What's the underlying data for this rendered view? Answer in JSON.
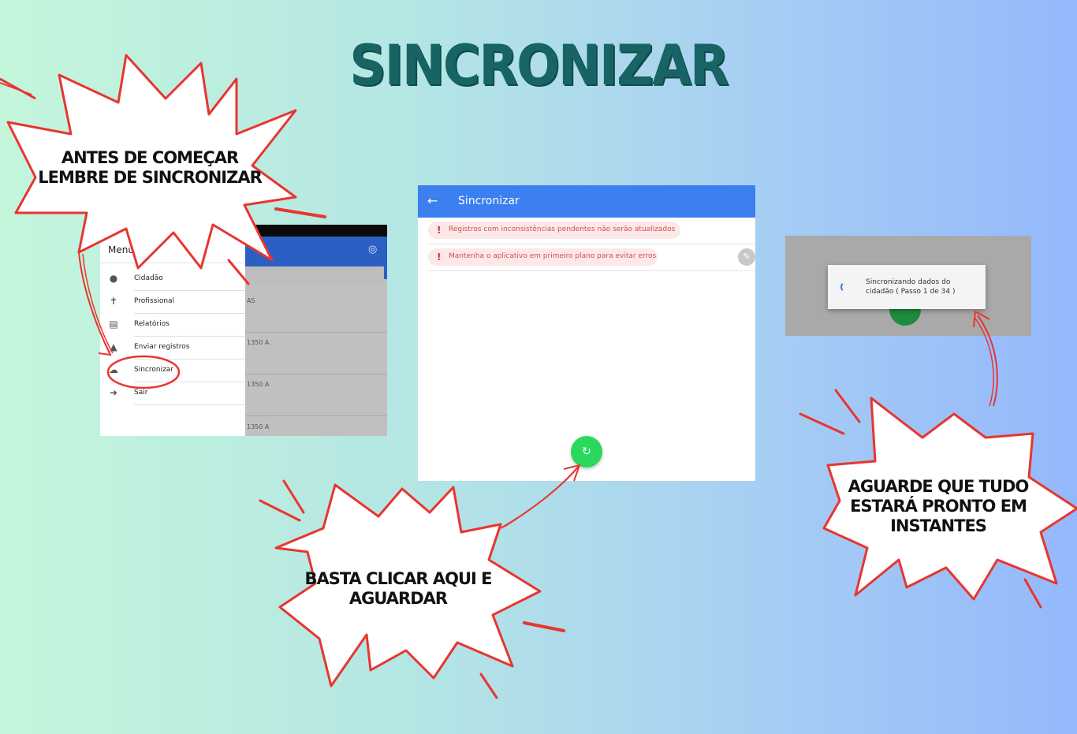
{
  "title": "SINCRONIZAR",
  "callouts": {
    "antes": [
      "ANTES DE COMEÇAR",
      "LEMBRE DE SINCRONIZAR"
    ],
    "basta": [
      "BASTA CLICAR AQUI E",
      "AGUARDAR"
    ],
    "aguarde": [
      "AGUARDE QUE TUDO",
      "ESTARÁ PRONTO EM",
      "INSTANTES"
    ]
  },
  "shot1": {
    "menu_title": "Menu",
    "menu_items": [
      {
        "label": "Cidadão",
        "icon": "person-icon"
      },
      {
        "label": "Profissional",
        "icon": "accessibility-icon"
      },
      {
        "label": "Relatórios",
        "icon": "report-icon"
      },
      {
        "label": "Enviar registros",
        "icon": "upload-icon"
      },
      {
        "label": "Sincronizar",
        "icon": "cloud-sync-icon"
      },
      {
        "label": "Sair",
        "icon": "exit-icon"
      }
    ],
    "background_rows": [
      "AS",
      "1350 A",
      "1350 A",
      "1350 A"
    ]
  },
  "shot2": {
    "app_title": "Sincronizar",
    "warnings": [
      "Registros com inconsistências pendentes não serão atualizados",
      "Mantenha o aplicativo em primeiro plano para evitar erros"
    ]
  },
  "shot3": {
    "dialog_line1": "Sincronizando dados do",
    "dialog_line2": "cidadão ( Passo 1 de 34 )"
  },
  "colors": {
    "title": "#186464",
    "callout_stroke": "#e8352e",
    "app_bar": "#3b7ff0",
    "fab": "#2ad85c",
    "warning_text": "#d05050"
  }
}
